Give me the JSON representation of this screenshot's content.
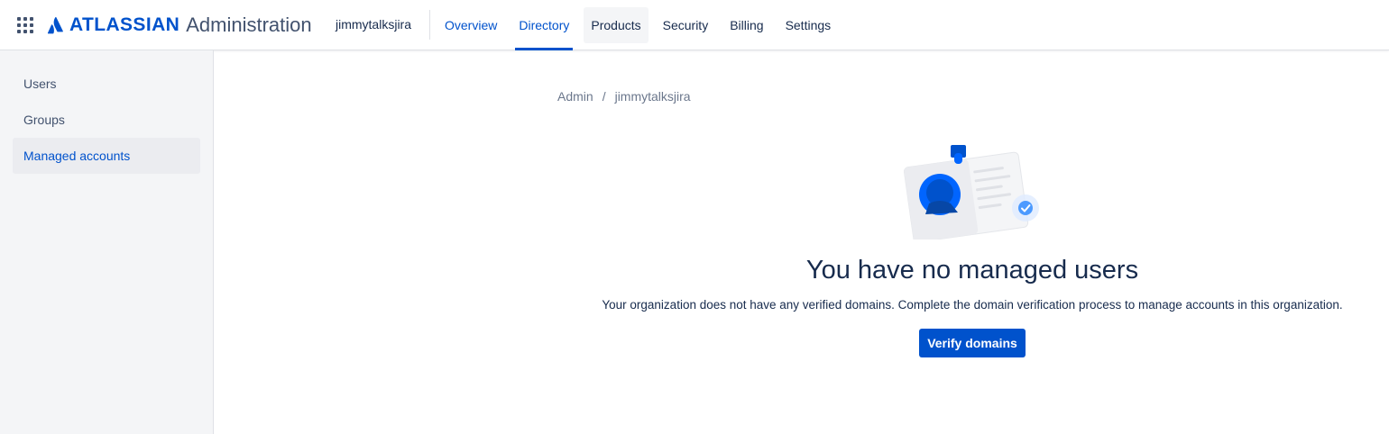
{
  "header": {
    "logo_word": "ATLASSIAN",
    "product_name": "Administration",
    "org_name": "jimmytalksjira",
    "nav": [
      {
        "label": "Overview"
      },
      {
        "label": "Directory"
      },
      {
        "label": "Products"
      },
      {
        "label": "Security"
      },
      {
        "label": "Billing"
      },
      {
        "label": "Settings"
      }
    ],
    "active_nav": "Directory"
  },
  "sidebar": {
    "items": [
      {
        "label": "Users"
      },
      {
        "label": "Groups"
      },
      {
        "label": "Managed accounts"
      }
    ],
    "selected": "Managed accounts"
  },
  "breadcrumb": {
    "items": [
      "Admin",
      "jimmytalksjira"
    ],
    "separator": "/"
  },
  "empty_state": {
    "title": "You have no managed users",
    "description": "Your organization does not have any verified domains. Complete the domain verification process to manage accounts in this organization.",
    "button_label": "Verify domains"
  },
  "icons": {
    "app_switcher": "app-switcher-grid-icon",
    "logo": "atlassian-logo-icon",
    "illustration": "id-card-illustration-icon"
  },
  "colors": {
    "brand": "#0052cc",
    "text": "#172b4d",
    "subtle_text": "#6b778c",
    "sidebar_bg": "#f4f5f7"
  }
}
